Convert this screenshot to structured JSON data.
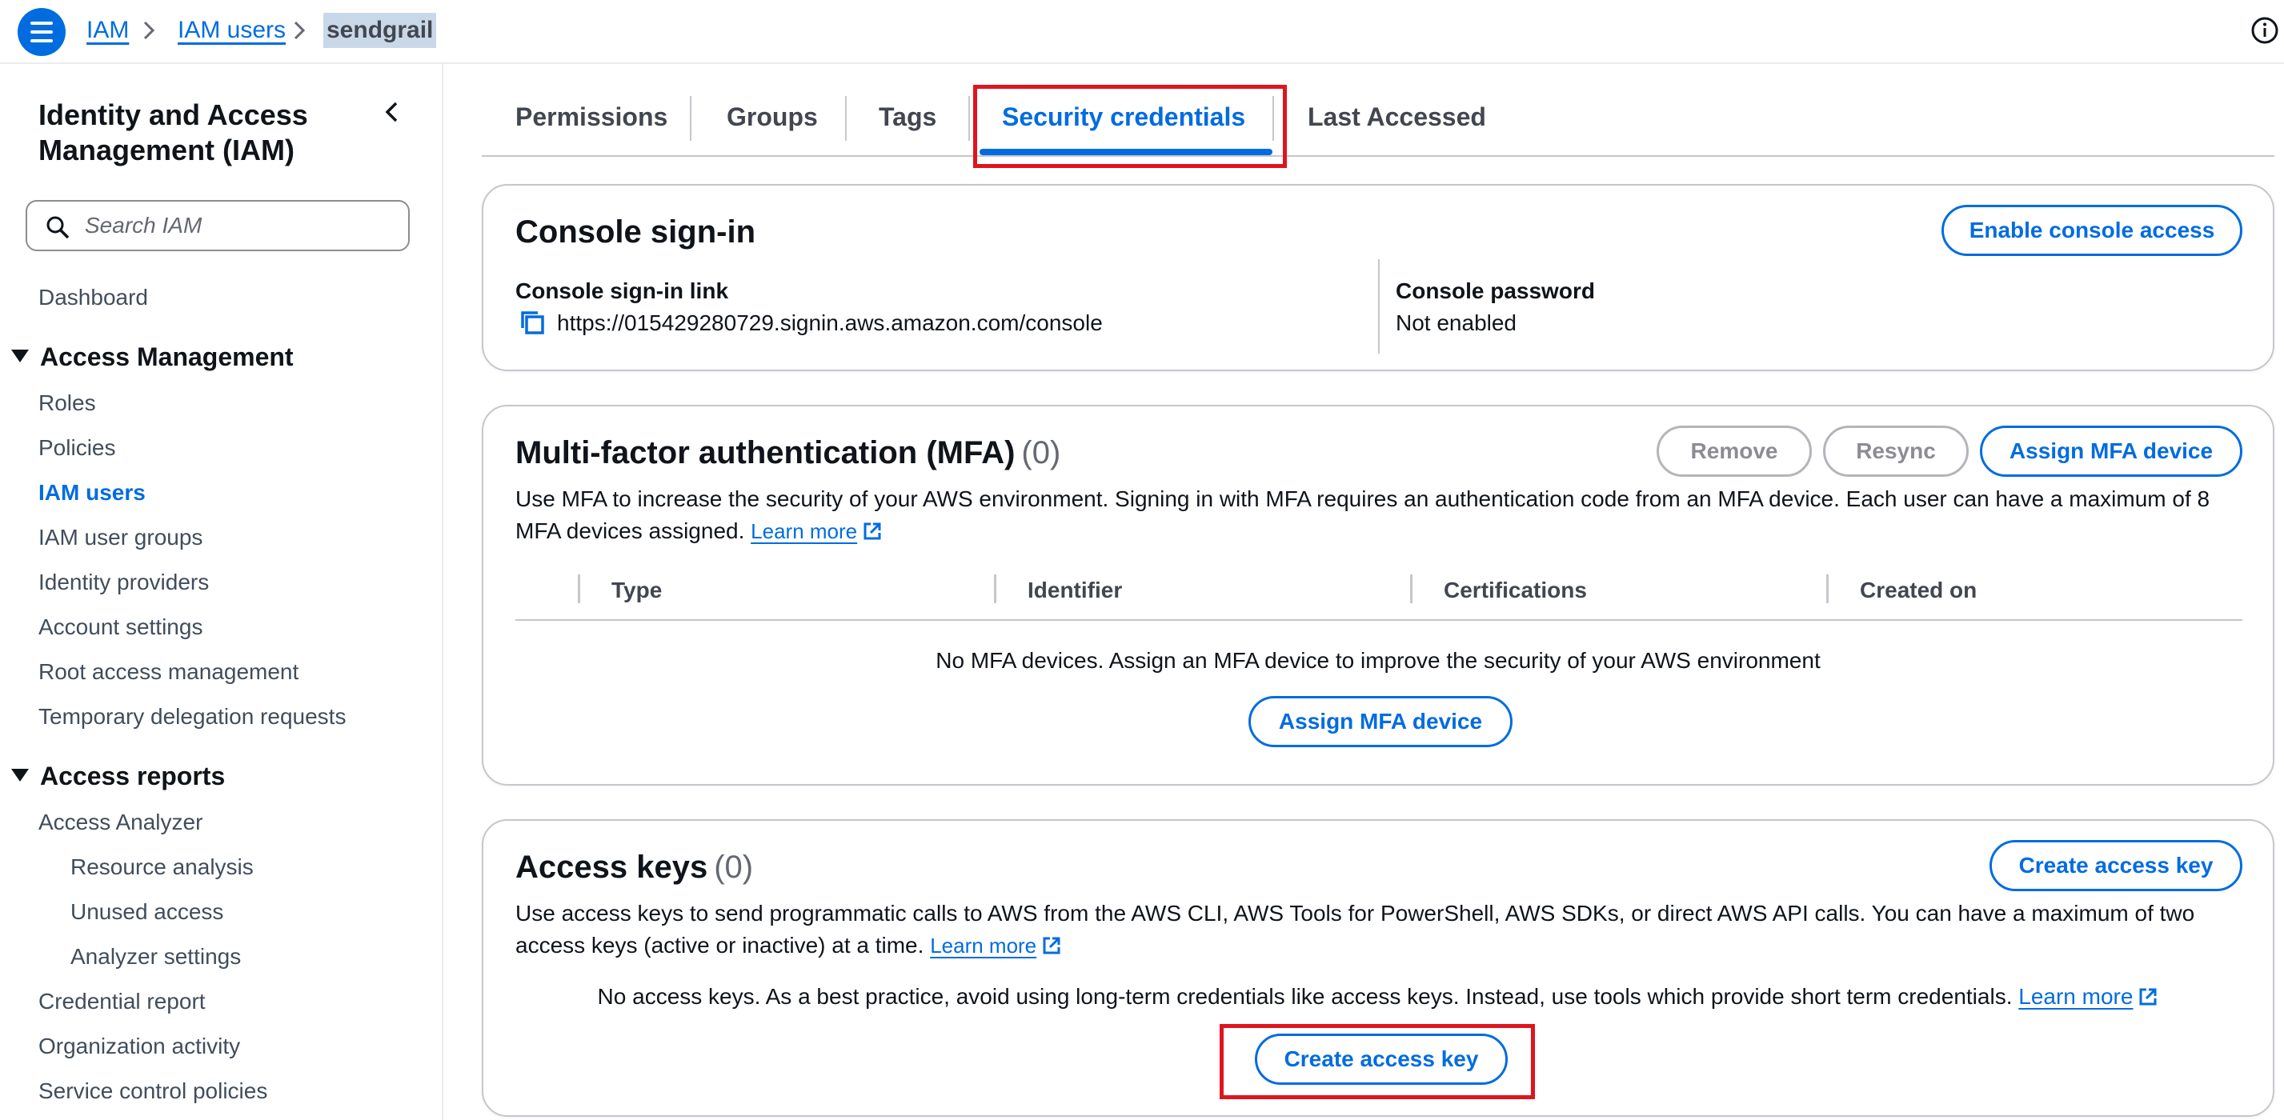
{
  "breadcrumb": {
    "items": [
      "IAM",
      "IAM users"
    ],
    "current": "sendgrail"
  },
  "sidebar": {
    "title": "Identity and Access Management (IAM)",
    "search_placeholder": "Search IAM",
    "dashboard": "Dashboard",
    "access_management": {
      "heading": "Access Management",
      "items": [
        "Roles",
        "Policies",
        "IAM users",
        "IAM user groups",
        "Identity providers",
        "Account settings",
        "Root access management",
        "Temporary delegation requests"
      ],
      "active": "IAM users"
    },
    "access_reports": {
      "heading": "Access reports",
      "items": [
        "Access Analyzer",
        "Resource analysis",
        "Unused access",
        "Analyzer settings",
        "Credential report",
        "Organization activity",
        "Service control policies"
      ]
    }
  },
  "tabs": {
    "items": [
      "Permissions",
      "Groups",
      "Tags",
      "Security credentials",
      "Last Accessed"
    ],
    "active": "Security credentials"
  },
  "console_signin": {
    "title": "Console sign-in",
    "enable_button": "Enable console access",
    "link_label": "Console sign-in link",
    "link_value": "https://015429280729.signin.aws.amazon.com/console",
    "password_label": "Console password",
    "password_value": "Not enabled"
  },
  "mfa": {
    "title": "Multi-factor authentication (MFA)",
    "count": "(0)",
    "remove_button": "Remove",
    "resync_button": "Resync",
    "assign_button": "Assign MFA device",
    "description": "Use MFA to increase the security of your AWS environment. Signing in with MFA requires an authentication code from an MFA device. Each user can have a maximum of 8 MFA devices assigned.",
    "learn_more": "Learn more",
    "columns": [
      "Type",
      "Identifier",
      "Certifications",
      "Created on"
    ],
    "empty_message": "No MFA devices. Assign an MFA device to improve the security of your AWS environment",
    "empty_assign_button": "Assign MFA device"
  },
  "access_keys": {
    "title": "Access keys",
    "count": "(0)",
    "create_button": "Create access key",
    "description": "Use access keys to send programmatic calls to AWS from the AWS CLI, AWS Tools for PowerShell, AWS SDKs, or direct AWS API calls. You can have a maximum of two access keys (active or inactive) at a time.",
    "learn_more": "Learn more",
    "empty_message": "No access keys. As a best practice, avoid using long-term credentials like access keys. Instead, use tools which provide short term credentials.",
    "empty_learn_more": "Learn more",
    "empty_create_button": "Create access key"
  },
  "colors": {
    "accent": "#006ce0",
    "highlight": "#e0141e",
    "border": "#c6c6cd"
  }
}
